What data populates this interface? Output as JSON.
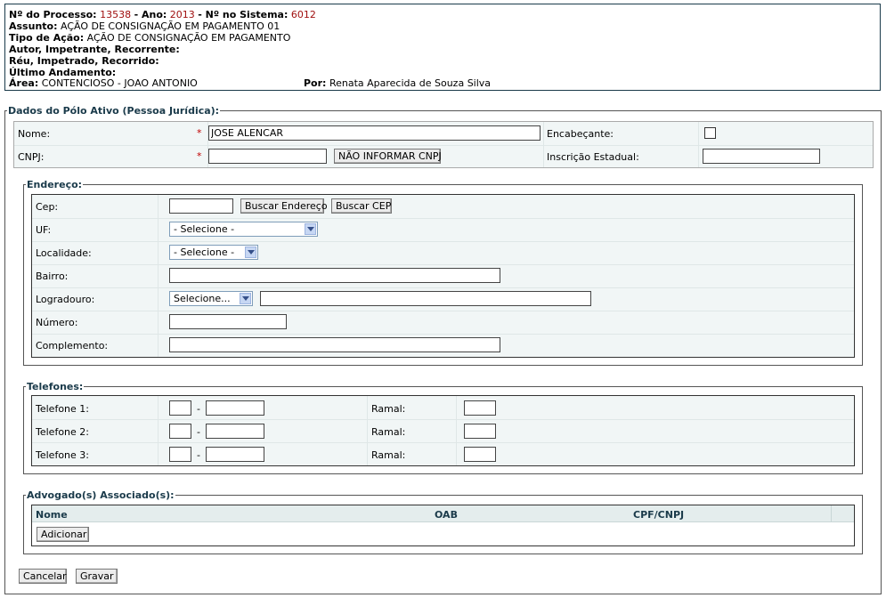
{
  "header": {
    "processo_label": "Nº do Processo:",
    "processo_value": "13538",
    "ano_label": "- Ano:",
    "ano_value": "2013",
    "sistema_label": "- Nº no Sistema:",
    "sistema_value": "6012",
    "assunto_label": "Assunto:",
    "assunto_value": "AÇÃO DE CONSIGNAÇÃO EM PAGAMENTO 01",
    "tipo_label": "Tipo de Ação:",
    "tipo_value": "AÇÃO DE CONSIGNAÇÃO EM PAGAMENTO",
    "autor_label": "Autor, Impetrante, Recorrente:",
    "reu_label": "Réu, Impetrado, Recorrido:",
    "andamento_label": "Último Andamento:",
    "area_label": "Área:",
    "area_value": "CONTENCIOSO - JOAO ANTONIO",
    "por_label": "Por:",
    "por_value": "Renata Aparecida de Souza Silva"
  },
  "polo": {
    "legend": "Dados do Pólo Ativo (Pessoa Jurídica):",
    "nome_label": "Nome:",
    "nome_value": "JOSE ALENCAR",
    "required_mark": "*",
    "encabecante_label": "Encabeçante:",
    "encabecante_checked": false,
    "cnpj_label": "CNPJ:",
    "cnpj_value": "",
    "nao_informar_cnpj": "NÃO INFORMAR CNPJ",
    "inscricao_label": "Inscrição Estadual:",
    "inscricao_value": ""
  },
  "endereco": {
    "legend": "Endereço:",
    "cep_label": "Cep:",
    "buscar_endereco": "Buscar Endereço",
    "buscar_cep": "Buscar CEP",
    "uf_label": "UF:",
    "uf_selected": "- Selecione -",
    "localidade_label": "Localidade:",
    "localidade_selected": "- Selecione -",
    "bairro_label": "Bairro:",
    "logradouro_label": "Logradouro:",
    "logradouro_selected": "Selecione...",
    "numero_label": "Número:",
    "complemento_label": "Complemento:"
  },
  "telefones": {
    "legend": "Telefones:",
    "separator": "-",
    "ramal_label": "Ramal:",
    "rows": [
      {
        "label": "Telefone 1:"
      },
      {
        "label": "Telefone 2:"
      },
      {
        "label": "Telefone 3:"
      }
    ]
  },
  "advogados": {
    "legend": "Advogado(s) Associado(s):",
    "columns": [
      "Nome",
      "OAB",
      "CPF/CNPJ"
    ],
    "adicionar": "Adicionar"
  },
  "footer": {
    "cancelar": "Cancelar",
    "gravar": "Gravar"
  },
  "colors": {
    "red_value": "#a01010",
    "legend_text": "#1a3a4a",
    "table_bg": "#f1f6f6"
  }
}
